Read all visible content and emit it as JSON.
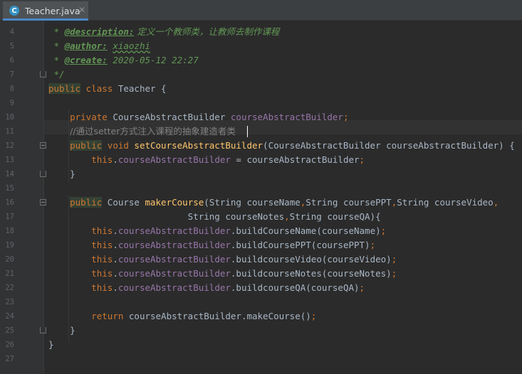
{
  "tab": {
    "icon": "C",
    "label": "Teacher.java",
    "close": "✕"
  },
  "lines": [
    {
      "n": "4"
    },
    {
      "n": "5"
    },
    {
      "n": "6"
    },
    {
      "n": "7"
    },
    {
      "n": "8"
    },
    {
      "n": "9"
    },
    {
      "n": "10"
    },
    {
      "n": "11"
    },
    {
      "n": "12"
    },
    {
      "n": "13"
    },
    {
      "n": "14"
    },
    {
      "n": "15"
    },
    {
      "n": "16"
    },
    {
      "n": "17"
    },
    {
      "n": "18"
    },
    {
      "n": "19"
    },
    {
      "n": "20"
    },
    {
      "n": "21"
    },
    {
      "n": "22"
    },
    {
      "n": "23"
    },
    {
      "n": "24"
    },
    {
      "n": "25"
    },
    {
      "n": "26"
    },
    {
      "n": "27"
    }
  ],
  "code": {
    "l4": {
      "star": " * ",
      "tag": "@description:",
      "text": " 定义一个教师类，让教师去制作课程"
    },
    "l5": {
      "star": " * ",
      "tag": "@author:",
      "space": " ",
      "value": "xiaozhi"
    },
    "l6": {
      "star": " * ",
      "tag": "@create:",
      "text": " 2020-05-12 22:27"
    },
    "l7": {
      "text": " */"
    },
    "l8": {
      "kw1": "public",
      "kw2": " class ",
      "name": "Teacher {"
    },
    "l10": {
      "indent": "    ",
      "kw": "private",
      "type": " CourseAbstractBuilder ",
      "field": "courseAbstractBuilder",
      "semi": ";"
    },
    "l11": {
      "indent": "    ",
      "comment": "//通过setter方式注入课程的抽象建造者类"
    },
    "l12": {
      "indent": "    ",
      "kw1": "public",
      "kw2": " void ",
      "method": "setCourseAbstractBuilder",
      "params": "(CourseAbstractBuilder courseAbstractBuilder) {"
    },
    "l13": {
      "indent": "        ",
      "kw": "this",
      "dot": ".",
      "field": "courseAbstractBuilder",
      "rest": " = courseAbstractBuilder",
      "semi": ";"
    },
    "l14": {
      "text": "    }"
    },
    "l16": {
      "indent": "    ",
      "kw": "public",
      "type": " Course ",
      "method": "makerCourse",
      "p1": "(String courseName",
      "c1": ",",
      "p2": "String coursePPT",
      "c2": ",",
      "p3": "String courseVideo",
      "c3": ","
    },
    "l17": {
      "indent": "                          ",
      "p1": "String courseNotes",
      "c1": ",",
      "p2": "String courseQA){"
    },
    "l18": {
      "indent": "        ",
      "kw": "this",
      "dot": ".",
      "field": "courseAbstractBuilder",
      "call": ".buildCourseName(courseName)",
      "semi": ";"
    },
    "l19": {
      "indent": "        ",
      "kw": "this",
      "dot": ".",
      "field": "courseAbstractBuilder",
      "call": ".buildCoursePPT(coursePPT)",
      "semi": ";"
    },
    "l20": {
      "indent": "        ",
      "kw": "this",
      "dot": ".",
      "field": "courseAbstractBuilder",
      "call": ".buildcourseVideo(courseVideo)",
      "semi": ";"
    },
    "l21": {
      "indent": "        ",
      "kw": "this",
      "dot": ".",
      "field": "courseAbstractBuilder",
      "call": ".buildcourseNotes(courseNotes)",
      "semi": ";"
    },
    "l22": {
      "indent": "        ",
      "kw": "this",
      "dot": ".",
      "field": "courseAbstractBuilder",
      "call": ".buildcourseQA(courseQA)",
      "semi": ";"
    },
    "l24": {
      "indent": "        ",
      "kw": "return",
      "rest": " courseAbstractBuilder.makeCourse()",
      "semi": ";"
    },
    "l25": {
      "text": "    }"
    },
    "l26": {
      "text": "}"
    }
  }
}
